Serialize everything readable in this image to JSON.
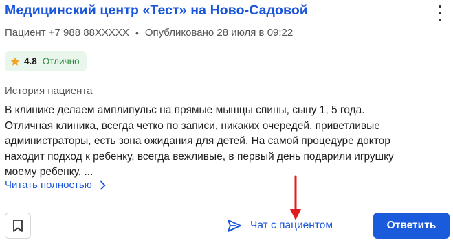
{
  "card": {
    "title": "Медицинский центр «Тест» на Ново-Садовой",
    "patient": "Пациент +7 988 88XXXXX",
    "separator": "•",
    "published": "Опубликовано 28 июля в 09:22",
    "rating": {
      "score": "4.8",
      "label": "Отлично",
      "star_color": "#f2a322",
      "badge_bg": "#e9f6ec"
    },
    "history_label": "История пациента",
    "review_lines": [
      "В клинике делаем амплипульс на прямые мышцы спины, сыну 1, 5 года.",
      "Отличная клиника, всегда четко по записи, никаких очередей, приветливые",
      "администраторы, есть зона ожидания для детей. На самой процедуре доктор",
      "находит подход к ребенку, всегда вежливые, в первый день подарили игрушку",
      "моему ребенку, ..."
    ],
    "read_more": "Читать полностью",
    "chat_label": "Чат с пациентом",
    "reply_label": "Ответить",
    "icons": {
      "more": "kebab-menu-icon",
      "star": "star-icon",
      "chevron": "chevron-right-icon",
      "bookmark": "bookmark-icon",
      "send": "send-icon",
      "annotation": "red-arrow"
    },
    "colors": {
      "accent": "#1a56db",
      "primary_button": "#1a5bdb",
      "annotation_arrow": "#e01c1c"
    }
  }
}
